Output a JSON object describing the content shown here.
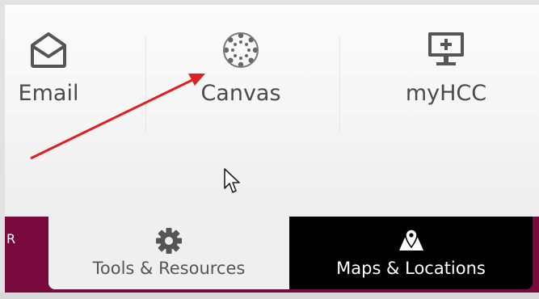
{
  "quick_links": [
    {
      "label": "Email",
      "icon": "envelope-icon"
    },
    {
      "label": "Canvas",
      "icon": "canvas-logo-icon"
    },
    {
      "label": "myHCC",
      "icon": "monitor-plus-icon"
    }
  ],
  "edge_text": "R",
  "tabs": [
    {
      "label": "Tools & Resources",
      "icon": "gear-icon",
      "active": false
    },
    {
      "label": "Maps & Locations",
      "icon": "map-pin-icon",
      "active": true
    }
  ],
  "colors": {
    "maroon": "#7a0a3e",
    "annotation_arrow": "#e02020",
    "active_tab": "#000000",
    "inactive_tab": "#efefef"
  }
}
